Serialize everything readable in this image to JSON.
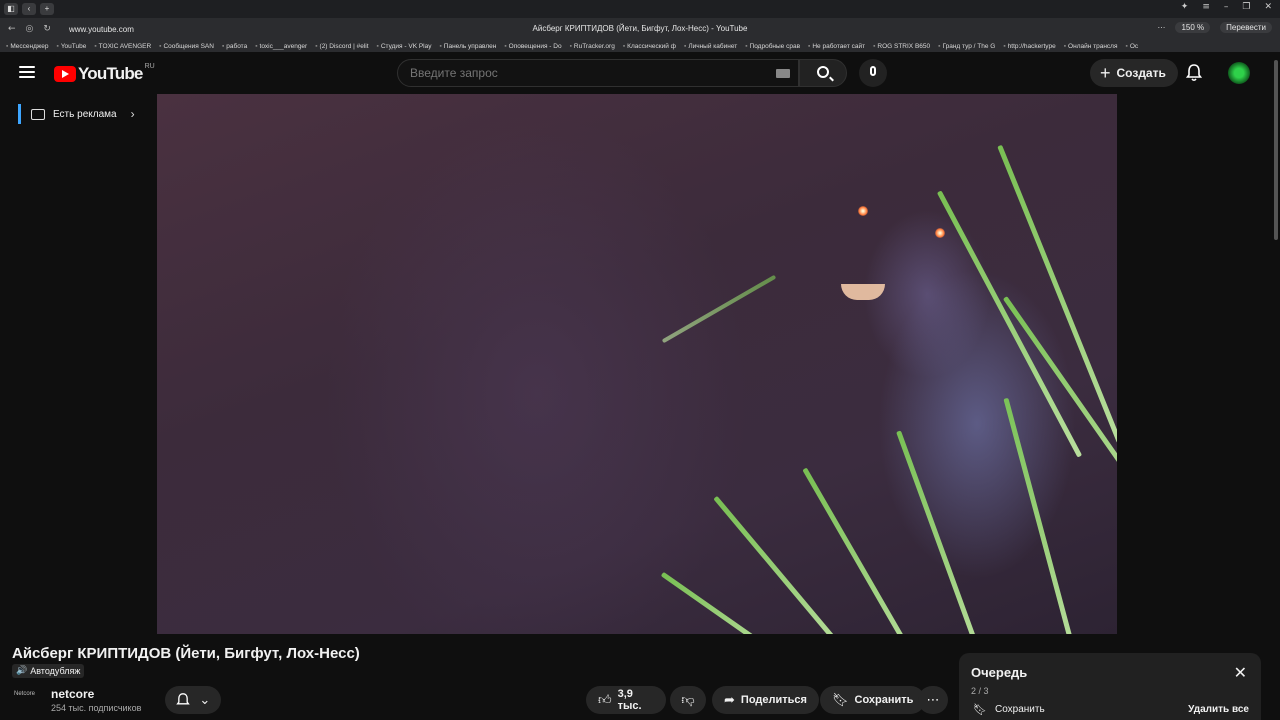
{
  "browser": {
    "url": "www.youtube.com",
    "tab_title": "Айсберг КРИПТИДОВ (Йети, Бигфут, Лох-Несс) - YouTube",
    "zoom": "150 %",
    "translate": "Перевести",
    "bookmarks": [
      "Мессенджер",
      "YouTube",
      "TOXIC AVENGER",
      "Сообщения SAN",
      "работа",
      "toxic___avenger",
      "(2) Discord | #elit",
      "Студия - VK Play",
      "Панель управлен",
      "Оповещения - Do",
      "RuTracker.org",
      "Классический ф",
      "Личный кабинет",
      "Подробные срав",
      "Не работает сайт",
      "ROG STRIX B650",
      "Гранд тур / The G",
      "http://hackertype",
      "Онлайн трансля",
      "Ос"
    ]
  },
  "header": {
    "logo_text": "YouTube",
    "logo_region": "RU",
    "search_placeholder": "Введите запрос",
    "create_label": "Создать"
  },
  "ad_chip": {
    "label": "Есть реклама"
  },
  "video": {
    "title": "Айсберг КРИПТИДОВ (Йети, Бигфут, Лох-Несс)",
    "dub_label": "Автодубляж",
    "channel_logo": "Netcore",
    "channel_name": "netcore",
    "subscribers": "254 тыс. подписчиков",
    "likes": "3,9 тыс.",
    "share_label": "Поделиться",
    "save_label": "Сохранить"
  },
  "queue": {
    "title": "Очередь",
    "count": "2 / 3",
    "save_label": "Сохранить",
    "delete_all_label": "Удалить все"
  },
  "colors": {
    "brand_red": "#ff0000",
    "background": "#0f0f0f",
    "chip": "#272727",
    "accent_blue": "#3ea6ff"
  }
}
